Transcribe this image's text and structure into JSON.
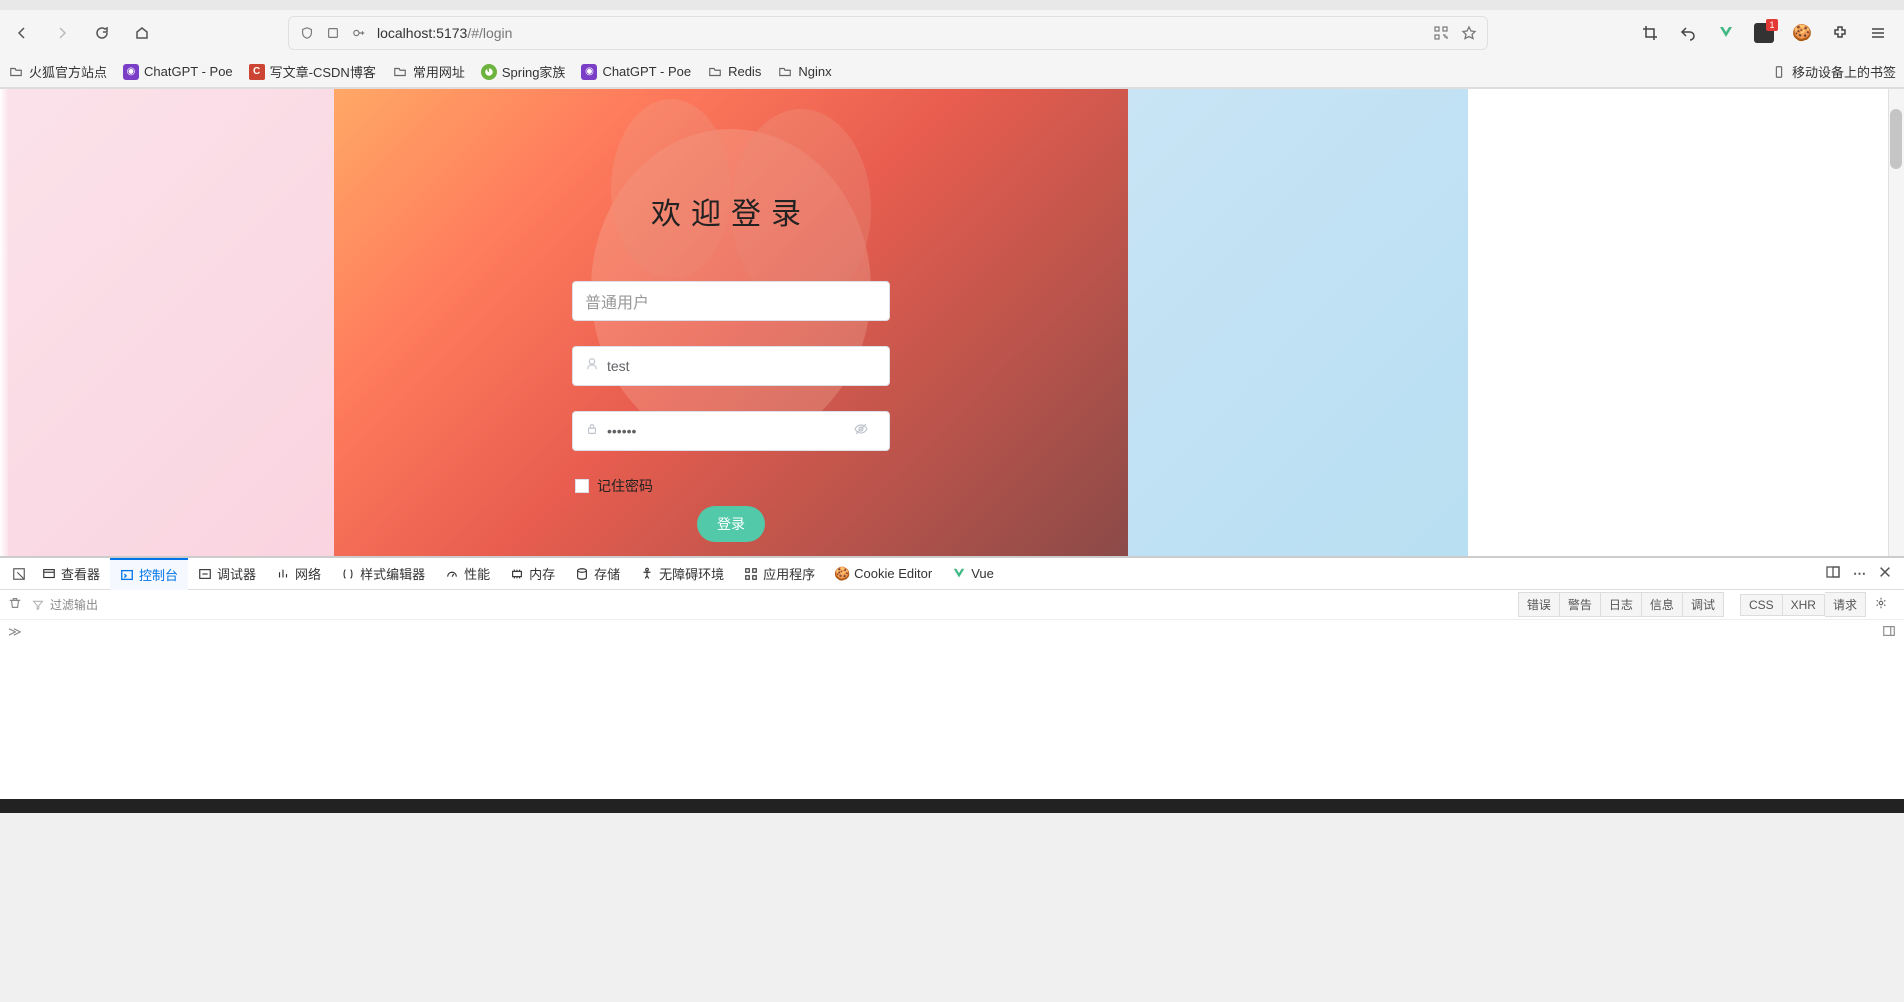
{
  "browser": {
    "url_host": "localhost",
    "url_port": ":5173",
    "url_path": "/#/login"
  },
  "toolbarExt": {
    "badge_count": "1"
  },
  "bookmarks": {
    "items": [
      {
        "label": "火狐官方站点",
        "icon": "folder"
      },
      {
        "label": "ChatGPT - Poe",
        "icon": "purple"
      },
      {
        "label": "写文章-CSDN博客",
        "icon": "red"
      },
      {
        "label": "常用网址",
        "icon": "folder"
      },
      {
        "label": "Spring家族",
        "icon": "spring"
      },
      {
        "label": "ChatGPT - Poe",
        "icon": "purple"
      },
      {
        "label": "Redis",
        "icon": "folder"
      },
      {
        "label": "Nginx",
        "icon": "folder"
      }
    ],
    "mobile_label": "移动设备上的书签"
  },
  "login": {
    "title": "欢迎登录",
    "role_placeholder": "普通用户",
    "username_value": "test",
    "password_value": "••••••",
    "remember_label": "记住密码",
    "submit_label": "登录"
  },
  "devtools": {
    "tabs": [
      {
        "label": "查看器",
        "icon": "inspect"
      },
      {
        "label": "控制台",
        "icon": "console"
      },
      {
        "label": "调试器",
        "icon": "debug"
      },
      {
        "label": "网络",
        "icon": "network"
      },
      {
        "label": "样式编辑器",
        "icon": "style"
      },
      {
        "label": "性能",
        "icon": "perf"
      },
      {
        "label": "内存",
        "icon": "memory"
      },
      {
        "label": "存储",
        "icon": "storage"
      },
      {
        "label": "无障碍环境",
        "icon": "a11y"
      },
      {
        "label": "应用程序",
        "icon": "app"
      },
      {
        "label": "Cookie Editor",
        "icon": "cookie"
      },
      {
        "label": "Vue",
        "icon": "vue"
      }
    ],
    "active_tab_index": 1,
    "filter_placeholder": "过滤输出",
    "chips": [
      "错误",
      "警告",
      "日志",
      "信息",
      "调试"
    ],
    "extra_chips": [
      "CSS",
      "XHR",
      "请求"
    ]
  }
}
